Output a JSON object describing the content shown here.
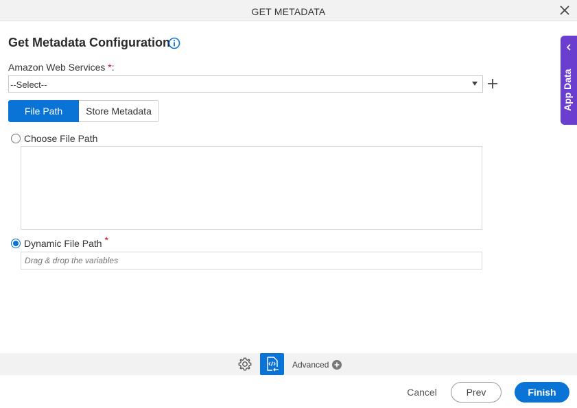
{
  "window": {
    "title": "GET METADATA"
  },
  "section": {
    "title": "Get Metadata Configuration"
  },
  "aws": {
    "label": "Amazon Web Services",
    "required_mark": "*",
    "suffix": ":",
    "selected": "--Select--"
  },
  "tabs": [
    {
      "label": "File Path",
      "active": true
    },
    {
      "label": "Store Metadata",
      "active": false
    }
  ],
  "options": {
    "choose": {
      "label": "Choose File Path",
      "checked": false
    },
    "dynamic": {
      "label": "Dynamic File Path",
      "checked": true,
      "required_mark": "*",
      "placeholder": "Drag & drop the variables"
    }
  },
  "side_panel": {
    "label": "App Data"
  },
  "toolbar": {
    "advanced_label": "Advanced"
  },
  "footer": {
    "cancel": "Cancel",
    "prev": "Prev",
    "finish": "Finish"
  },
  "colors": {
    "accent": "#0a74d6",
    "side_panel": "#6a3fcf",
    "required": "#d0021b"
  },
  "icons": [
    "close-icon",
    "info-icon",
    "chevron-down-icon",
    "plus-icon",
    "chevron-left-icon",
    "gear-icon",
    "code-icon",
    "plus-circle-icon"
  ]
}
